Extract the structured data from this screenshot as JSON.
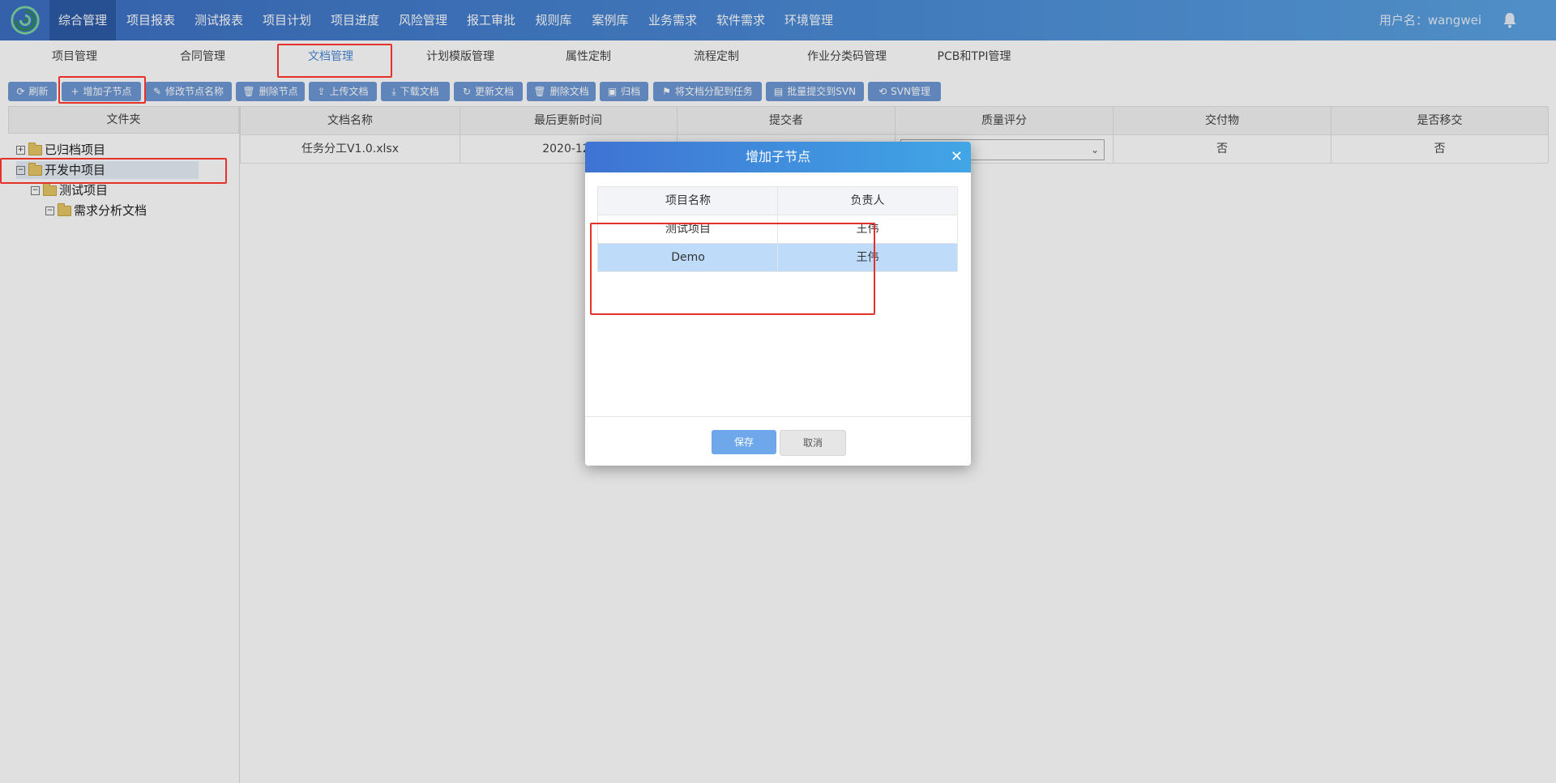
{
  "top_nav": {
    "items": [
      "综合管理",
      "项目报表",
      "测试报表",
      "项目计划",
      "项目进度",
      "风险管理",
      "报工审批",
      "规则库",
      "案例库",
      "业务需求",
      "软件需求",
      "环境管理"
    ],
    "active_index": 0,
    "user_label": "用户名：wangwei",
    "bell_icon": "bell-icon",
    "logo_icon": "swirl-logo"
  },
  "sub_nav": {
    "items": [
      "项目管理",
      "合同管理",
      "文档管理",
      "计划模版管理",
      "属性定制",
      "流程定制",
      "作业分类码管理",
      "PCB和TPI管理"
    ],
    "active_index": 2
  },
  "toolbar": {
    "buttons": [
      {
        "label": "刷新",
        "icon": "refresh-icon"
      },
      {
        "label": "增加子节点",
        "icon": "plus-icon"
      },
      {
        "label": "修改节点名称",
        "icon": "edit-icon"
      },
      {
        "label": "删除节点",
        "icon": "trash-icon"
      },
      {
        "label": "上传文档",
        "icon": "upload-icon"
      },
      {
        "label": "下载文档",
        "icon": "download-icon"
      },
      {
        "label": "更新文档",
        "icon": "refresh-icon"
      },
      {
        "label": "删除文档",
        "icon": "trash-icon"
      },
      {
        "label": "归档",
        "icon": "archive-icon"
      },
      {
        "label": "将文档分配到任务",
        "icon": "flag-icon"
      },
      {
        "label": "批量提交到SVN",
        "icon": "batch-icon"
      },
      {
        "label": "SVN管理",
        "icon": "svn-icon"
      }
    ]
  },
  "tree": {
    "header": "文件夹",
    "nodes": [
      {
        "label": "已归档项目",
        "toggle": "+"
      },
      {
        "label": "开发中项目",
        "toggle": "−"
      },
      {
        "label": "测试项目",
        "toggle": "−"
      },
      {
        "label": "需求分析文档",
        "toggle": "−"
      }
    ]
  },
  "table": {
    "headers": [
      "文档名称",
      "最后更新时间",
      "提交者",
      "质量评分",
      "交付物",
      "是否移交"
    ],
    "rows": [
      {
        "name": "任务分工V1.0.xlsx",
        "updated": "2020-12-",
        "submitter": "",
        "score": "",
        "deliverable": "否",
        "handover": "否"
      }
    ]
  },
  "modal": {
    "title": "增加子节点",
    "close_icon": "close-icon",
    "headers": [
      "项目名称",
      "负责人"
    ],
    "rows": [
      {
        "name": "测试项目",
        "owner": "王伟"
      },
      {
        "name": "Demo",
        "owner": "王伟",
        "selected": true
      }
    ],
    "save_label": "保存",
    "cancel_label": "取消"
  },
  "colors": {
    "topbar": "#4b8bd6",
    "active_nav": "#2d5ca8",
    "toolbar_button": "#6d98d4",
    "selected_row": "#bedcfa",
    "annotation": "#e4322b",
    "save_button": "#6fa8ea"
  }
}
